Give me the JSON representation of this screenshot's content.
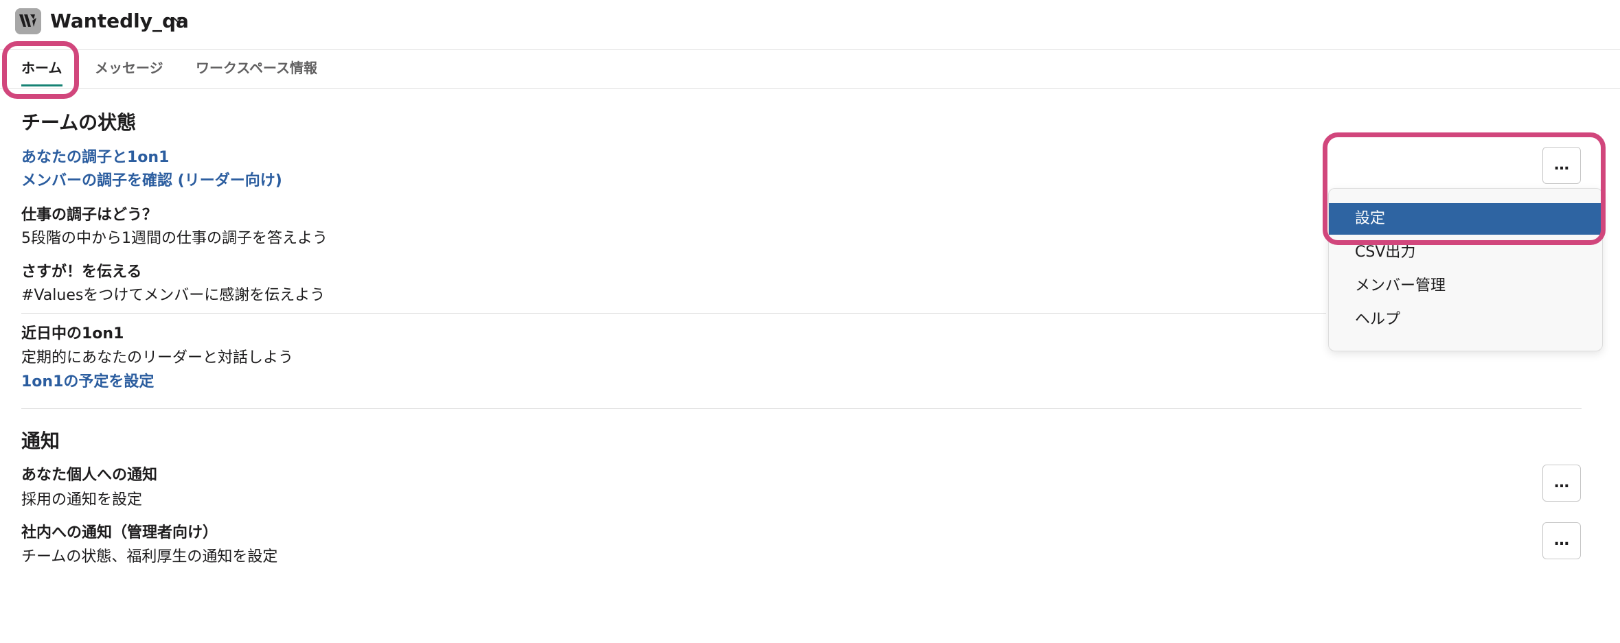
{
  "header": {
    "app_name": "Wantedly_qa"
  },
  "tabs": [
    {
      "label": "ホーム",
      "active": true
    },
    {
      "label": "メッセージ",
      "active": false
    },
    {
      "label": "ワークスペース情報",
      "active": false
    }
  ],
  "team_status": {
    "title": "チームの状態",
    "links": [
      "あなたの調子と1on1",
      "メンバーの調子を確認 (リーダー向け)"
    ],
    "items": [
      {
        "title": "仕事の調子はどう？",
        "description": "5段階の中から1週間の仕事の調子を答えよう"
      },
      {
        "title": "さすが！を伝える",
        "description": "#Valuesをつけてメンバーに感謝を伝えよう"
      },
      {
        "title": "近日中の1on1",
        "description": "定期的にあなたのリーダーと対話しよう",
        "link": "1on1の予定を設定"
      }
    ]
  },
  "notifications": {
    "title": "通知",
    "items": [
      {
        "title": "あなた個人への通知",
        "description": "採用の通知を設定"
      },
      {
        "title": "社内への通知（管理者向け）",
        "description": "チームの状態、福利厚生の通知を設定"
      }
    ]
  },
  "more_button": {
    "label": "…"
  },
  "dropdown_menu": {
    "items": [
      {
        "label": "設定",
        "selected": true
      },
      {
        "label": "CSV出力",
        "selected": false
      },
      {
        "label": "メンバー管理",
        "selected": false
      },
      {
        "label": "ヘルプ",
        "selected": false
      }
    ]
  },
  "colors": {
    "link": "#2b5d9f",
    "tab_underline": "#178374",
    "menu_selected": "#2e64a2",
    "annotation": "#d1467c"
  }
}
